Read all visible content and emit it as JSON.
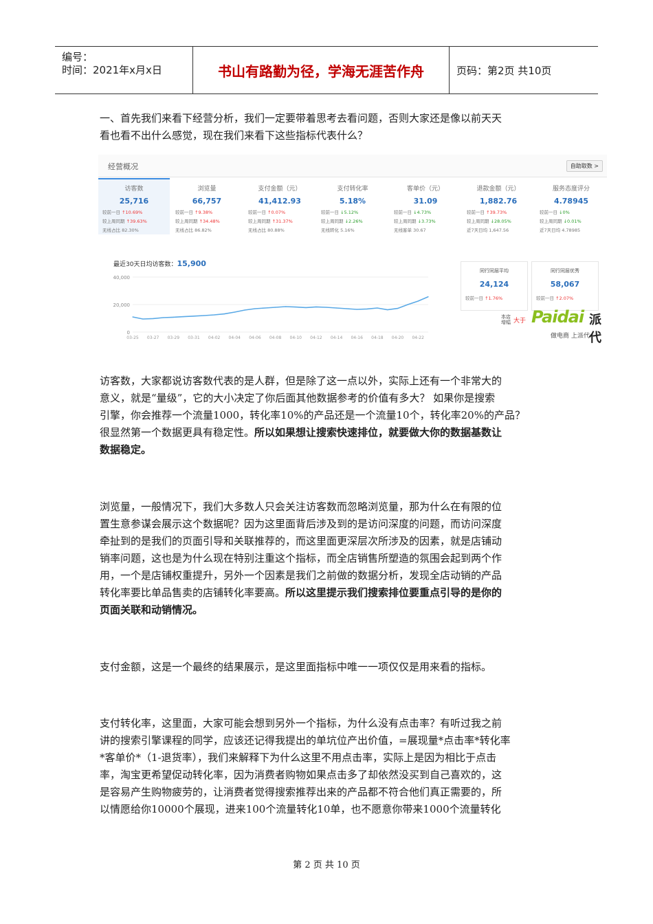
{
  "header": {
    "number_label": "编号：",
    "time_label": "时间：2021年x月x日",
    "motto": "书山有路勤为径，学海无涯苦作舟",
    "page_info": "页码：第2页  共10页"
  },
  "intro": {
    "line1": "一、首先我们来看下经营分析，我们一定要带着思考去看问题，否则大家还是像以前天天",
    "line2": "看也看不出什么感觉，现在我们来看下这些指标代表什么？"
  },
  "dashboard": {
    "title": "经营概况",
    "button": "自助取数 >",
    "metrics": [
      {
        "name": "访客数",
        "value": "25,716",
        "r1": "较前一日",
        "r1v": "10.69%",
        "r1d": "up",
        "r2": "较上周同期",
        "r2v": "39.63%",
        "r2d": "up",
        "r3": "无线占比",
        "r3v": "82.30%"
      },
      {
        "name": "浏览量",
        "value": "66,757",
        "r1": "较前一日",
        "r1v": "9.38%",
        "r1d": "up",
        "r2": "较上周同期",
        "r2v": "34.48%",
        "r2d": "up",
        "r3": "无线占比",
        "r3v": "86.82%"
      },
      {
        "name": "支付金额（元）",
        "value": "41,412.93",
        "r1": "较前一日",
        "r1v": "0.07%",
        "r1d": "up",
        "r2": "较上周同期",
        "r2v": "31.37%",
        "r2d": "up",
        "r3": "无线占比",
        "r3v": "80.88%"
      },
      {
        "name": "支付转化率",
        "value": "5.18%",
        "r1": "较前一日",
        "r1v": "5.12%",
        "r1d": "dn",
        "r2": "较上周同期",
        "r2v": "2.26%",
        "r2d": "dn",
        "r3": "无线转化",
        "r3v": "5.16%"
      },
      {
        "name": "客单价（元）",
        "value": "31.09",
        "r1": "较前一日",
        "r1v": "4.73%",
        "r1d": "dn",
        "r2": "较上周同期",
        "r2v": "3.73%",
        "r2d": "dn",
        "r3": "无线客单",
        "r3v": "30.67"
      },
      {
        "name": "退款金额（元）",
        "value": "1,882.76",
        "r1": "较前一日",
        "r1v": "39.73%",
        "r1d": "up",
        "r2": "较上周同期",
        "r2v": "28.05%",
        "r2d": "dn",
        "r3": "近7天日均",
        "r3v": "1,647.56"
      },
      {
        "name": "服务态度评分",
        "value": "4.78945",
        "r1": "较前一日",
        "r1v": "0%",
        "r1d": "dn",
        "r2": "较上周同期",
        "r2v": "0.01%",
        "r2d": "dn",
        "r3": "近7天日均",
        "r3v": "4.78985"
      }
    ],
    "chart_label": "最近30天日均访客数：",
    "chart_value": "15,900",
    "peer_avg": {
      "name": "同行同层平均",
      "value": "24,124",
      "r": "较前一日",
      "rv": "1.76%"
    },
    "peer_best": {
      "name": "同行同层优秀",
      "value": "58,067",
      "r": "较前一日",
      "rv": "2.07%"
    },
    "watermark": {
      "small": "本店增幅",
      "dayu": "大于",
      "logo": "Paidai",
      "cn": "派代",
      "tag": "做电商 上派代"
    }
  },
  "chart_data": {
    "type": "line",
    "title": "最近30天日均访客数：15,900",
    "x": [
      "03-25",
      "03-26",
      "03-27",
      "03-28",
      "03-29",
      "03-30",
      "03-31",
      "04-01",
      "04-02",
      "04-03",
      "04-04",
      "04-05",
      "04-06",
      "04-07",
      "04-08",
      "04-09",
      "04-10",
      "04-11",
      "04-12",
      "04-13",
      "04-14",
      "04-15",
      "04-16",
      "04-17",
      "04-18",
      "04-19",
      "04-20",
      "04-21",
      "04-22",
      "04-23"
    ],
    "xticks": [
      "03-25",
      "03-27",
      "03-29",
      "03-31",
      "04-02",
      "04-04",
      "04-06",
      "04-08",
      "04-10",
      "04-12",
      "04-14",
      "04-16",
      "04-18",
      "04-20",
      "04-22"
    ],
    "yticks": [
      "40,000",
      "20,000",
      "0"
    ],
    "ylim": [
      0,
      40000
    ],
    "series": [
      {
        "values": [
          11000,
          9500,
          9800,
          10500,
          10800,
          11200,
          11600,
          12000,
          12500,
          13200,
          14500,
          16000,
          17000,
          17500,
          18000,
          18500,
          18200,
          17800,
          18300,
          18000,
          17500,
          17000,
          16500,
          16800,
          17500,
          16200,
          17200,
          20000,
          22500,
          25700
        ]
      }
    ],
    "grid": true,
    "line_color": "#5aa9e6"
  },
  "paragraphs": {
    "visitors": {
      "l1": "访客数，大家都说访客数代表的是人群，但是除了这一点以外，实际上还有一个非常大的",
      "l2": "意义，就是“量级”，它的大小决定了你后面其他数据参考的价值有多大？  如果你是搜索",
      "l3": "引擎，你会推荐一个流量1000，转化率10%的产品还是一个流量10个，转化率20%的产品？",
      "l4a": " 很显然第一个数据更具有稳定性。",
      "l4b": "所以如果想让搜索快速排位，就要做大你的数据基数让",
      "l5": "数据稳定。"
    },
    "pageviews": {
      "l1": "浏览量，一般情况下，我们大多数人只会关注访客数而忽略浏览量，那为什么在有限的位",
      "l2": "置生意参谋会展示这个数据呢？因为这里面背后涉及到的是访问深度的问题，而访问深度",
      "l3": "牵扯到的是我们的页面引导和关联推荐的，而这里面更深层次所涉及的因素，就是店铺动",
      "l4": "销率问题，这也是为什么现在特别注重这个指标，而全店销售所塑造的氛围会起到两个作",
      "l5": "用，一个是店铺权重提升，另外一个因素是我们之前做的数据分析，发现全店动销的产品",
      "l6a": "转化率要比单品售卖的店铺转化率要高。",
      "l6b": "所以这里提示我们搜索排位要重点引导的是你的",
      "l7": "页面关联和动销情况。"
    },
    "payment": {
      "l1": "支付金额，这是一个最终的结果展示，是这里面指标中唯一一项仅仅是用来看的指标。"
    },
    "conversion": {
      "l1": "支付转化率，这里面，大家可能会想到另外一个指标，为什么没有点击率？有听过我之前",
      "l2": "讲的搜索引擎课程的同学，应该还记得我提出的单坑位产出价值，=展现量*点击率*转化率",
      "l3": "*客单价*（1-退货率），我们来解释下为什么这里不用点击率，实际上是因为相比于点击",
      "l4": "率，淘宝更希望促动转化率，因为消费者购物如果点击多了却依然没买到自己喜欢的，这",
      "l5": "是容易产生购物疲劳的，让消费者觉得搜索推荐出来的产品都不符合他们真正需要的，所",
      "l6": "以情愿给你10000个展现，进来100个流量转化10单，也不愿意你带来1000个流量转化"
    }
  },
  "footer": {
    "text": "第 2 页 共 10 页"
  }
}
